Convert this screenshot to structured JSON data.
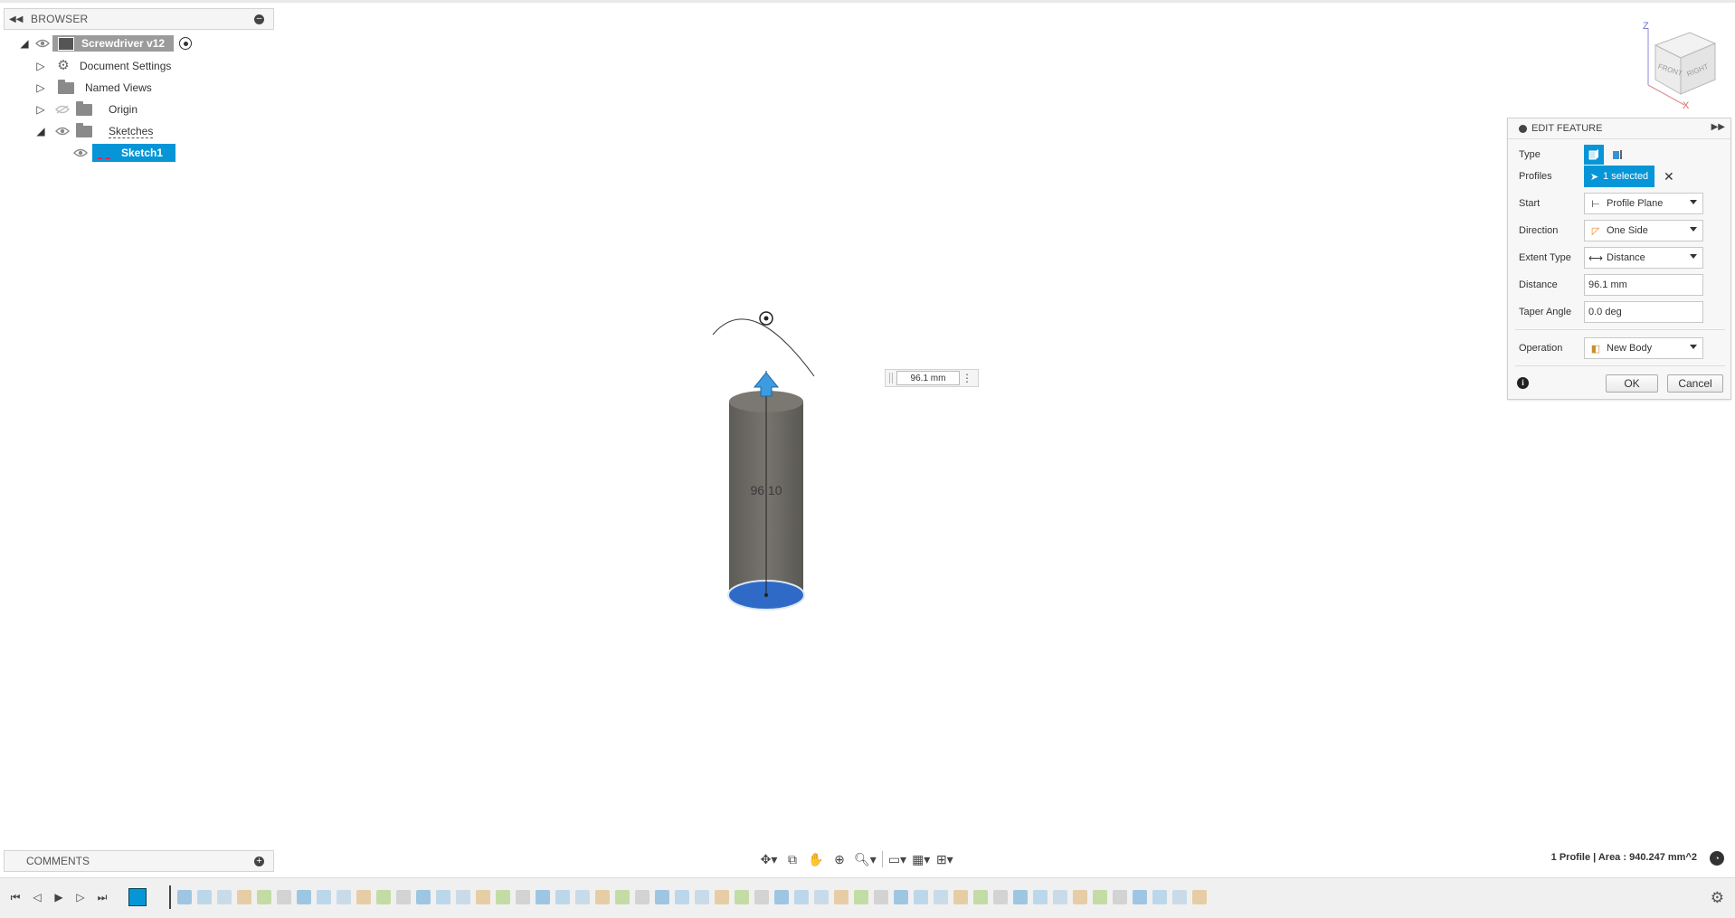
{
  "browser": {
    "title": "BROWSER",
    "root": "Screwdriver v12",
    "items": [
      {
        "label": "Document Settings"
      },
      {
        "label": "Named Views"
      },
      {
        "label": "Origin"
      },
      {
        "label": "Sketches"
      }
    ],
    "sketch": "Sketch1"
  },
  "comments": {
    "title": "COMMENTS"
  },
  "viewcube": {
    "front": "FRONT",
    "right": "RIGHT",
    "z": "Z",
    "x": "X"
  },
  "viewport": {
    "dimension_label": "96.10",
    "dimension_input": "96.1 mm"
  },
  "panel": {
    "title": "EDIT FEATURE",
    "type_label": "Type",
    "profiles_label": "Profiles",
    "profiles_value": "1 selected",
    "start_label": "Start",
    "start_value": "Profile Plane",
    "direction_label": "Direction",
    "direction_value": "One Side",
    "extent_label": "Extent Type",
    "extent_value": "Distance",
    "distance_label": "Distance",
    "distance_value": "96.1 mm",
    "taper_label": "Taper Angle",
    "taper_value": "0.0 deg",
    "operation_label": "Operation",
    "operation_value": "New Body",
    "ok": "OK",
    "cancel": "Cancel"
  },
  "status": {
    "text": "1 Profile | Area : 940.247 mm^2"
  },
  "colors": {
    "accent": "#0696d7",
    "model_body": "#6f6d66",
    "profile": "#2f6bc6"
  }
}
